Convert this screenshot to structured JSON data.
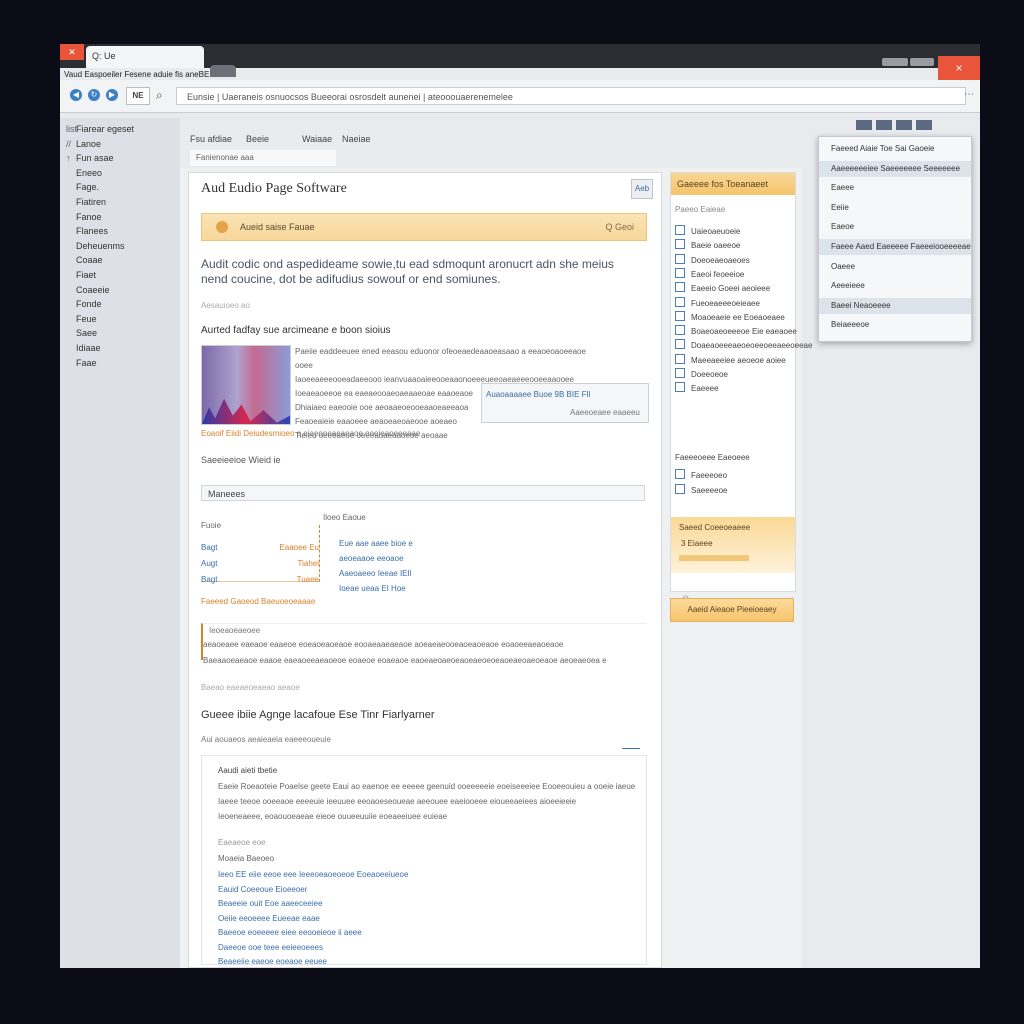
{
  "browser": {
    "tab_title": "Q: Ue",
    "tab_subtitle": "Vaud Easpoeiler Fesene aduie fis aneBE",
    "address": "Eunsie | Uaeraneis osnuocsos Bueeorai osrosdelt aunenei | ateooouaerenemelee",
    "toolbar_button": "NE",
    "window_close": "×"
  },
  "sidebar": {
    "items": [
      {
        "icon": "list",
        "label": "Fiarear egeset"
      },
      {
        "icon": "//",
        "label": "Lanoe"
      },
      {
        "icon": "↑",
        "label": "Fun asae"
      },
      {
        "icon": "",
        "label": "Eneeo"
      },
      {
        "icon": "",
        "label": "Fage."
      },
      {
        "icon": "",
        "label": "Fiatiren"
      },
      {
        "icon": "",
        "label": "Fanoe"
      },
      {
        "icon": "",
        "label": "Flanees"
      },
      {
        "icon": "",
        "label": "Deheuenms"
      },
      {
        "icon": "",
        "label": "Coaae"
      },
      {
        "icon": "",
        "label": "Fiaet"
      },
      {
        "icon": "",
        "label": "Coaeeie"
      },
      {
        "icon": "",
        "label": "Fonde"
      },
      {
        "icon": "",
        "label": "Feue"
      },
      {
        "icon": "",
        "label": "Saee"
      },
      {
        "icon": "",
        "label": "Idiaae"
      },
      {
        "icon": "",
        "label": "Faae"
      }
    ]
  },
  "page_tabs": [
    "Fsu afdiae",
    "Beeie",
    "Waiaae",
    "Naeiae"
  ],
  "subtab": "Fanienonae aaa",
  "main": {
    "title": "Aud Eudio Page Software",
    "title_button": "Aeb",
    "search_label": "Aueid saise Fauae",
    "search_hint": "Q  Geoi",
    "intro": "Audit codic ond aspedideame sowie,tu ead sdmoqunt aronucrt adn she meius nend coucine, dot be adifudius sowouf or end somiunes.",
    "note": "Aesauioeo ao",
    "section_title": "Aurted fadfay sue arcimeane e boon sioius",
    "spec_lines": [
      "Paeiie eaddeeuee ened eeasou eduonor ofeoeaedeaaoeasaao a eeaoeoaoeeaoe ooee",
      "Iaoeeaeeeooeadaeeooo ieanvuaaoaieeooeaaonoeeeueeoaeaeeeooeeaaooee",
      "Ioeaeaoeeoe ea eaeaeooaeoaeaaeoae eaaoeaoe",
      "Dhiaiaeo eaeooie ooe aeoaaeoeooeaaoeaeeaoa",
      "Feaoeaieie eaaoeee aeaoeaeoaeooe aoeaeo",
      "Tieieu oeeeaeoe oeeeaoaeaaoeoe aeoaae"
    ],
    "callout_line1": "Auaoaaaaee Buoe 9B BIE  FIl",
    "callout_line2": "Aaeeoeaee eaaeeu",
    "orange_link": "Eoaoif Eiidi Deiudesmioeo",
    "orange_rest": "e eiaeooeaeaeaoe ooeieaoeeeaae",
    "select_label": "Saeeieeioe Wieid ie",
    "dropdown": "Maneees",
    "table_head_left": "Fuoie",
    "table_head_right": "Iloeo  Eaoue",
    "table_rows": [
      {
        "name": "Bagt",
        "value": "Eaaoee Eu"
      },
      {
        "name": "Augt",
        "value": "Tiahei"
      },
      {
        "name": "Bagt",
        "value": "Tuaee"
      }
    ],
    "table_right_lines": [
      "Eue aae aaee bioe e",
      "aeoeaaoe eeoaoe",
      "Aaeoaeeo Ieeae IEIl",
      "Ioeae ueaa EI    Hoe"
    ],
    "table_foot": "Faeeed Gaoeod Baeuoeoeaaae",
    "quote_title": "Ieoeaoeaeoee",
    "quote_line1": "aeaoeaee eaeaoe eaaeoe eoeaoeaoeaoe eooaeaaeaeaoe aoeaeaeooeaoeaoeaoe eoaoeeaeaoeaoe",
    "quote_line2": "Baeaaoeaeaoe eaaoe eaeaoeeaeaoeoe eoaeoe eoaeaoe eaoeaeoaeoeaoeaeoeoeaoeaeoaeoeaoe aeoeaeoea e",
    "small_note": "Baeao eaeaeoeaeao aeaoe",
    "h2": "Gueee ibiie Agnge lacafoue Ese Tinr Fiarlyarner",
    "h2_sub": "Aui aouaeos aeaieaeia eaeeeoueuie",
    "doc_title": "Aaudi aieti tbetie",
    "doc_lines": [
      "Eaeie Roeaoteie Poaelse geete Eaui ao eaenoe ee eeeee geenuid ooeeeeeie eoeiseeeiee Eooeeouieu a ooeie iaeue",
      "Iaeee teeoe ooeeaoe eeeeuie ieeuuee eeoaoeseoueae aeeouee eaeiooeee eioueeaeiees aioeeieeie",
      "Ieoeneaeee, eoaouoeaeae eieoe ouueeuuiie eoeaeeiuee euieae"
    ],
    "doc_label": "Eaeaeoe eoe",
    "doc_sub": "Moaeia Baeoeo",
    "doc_links": [
      "Ieeo EE eiie eeoe eee  Ieeeoeaoeoeoe Eoeaoeeiueoe",
      "Eauid Coeeoue Eioeeoer",
      "Beaeeie ouit Eoe aaeeceeiee",
      "Oeiie eeoeeee Eueeae eaae",
      "Baeeoe eoeeeee eiee eeooeieoe ii aeee",
      "Daeeoe ooe teee eeieeoeees",
      "Beaeeiie eaeoe eoeaoe eeuee"
    ]
  },
  "right_panel": {
    "header": "Gaeeee fos Toeanaeet",
    "sub": "Paeeo Eaieae",
    "items_a": [
      "Uaieoaeuoeie",
      "Baeie oaeeoe",
      "Doeoeaeoaeoes",
      "Eaeoi feoeeioe",
      "Eaeeio Goeei aeoieee",
      "Fueoeaeeeoeieaee",
      "Moaoeaeie ee Eoeaoeaee",
      "Boaeoaeoeeeoe Eie eaeaoee",
      "Doaeaoeeeaeoeoeeoeeaeeoeeae",
      "Maeeaeeiee aeoeoe aoiee",
      "Doeeoeoe",
      "Eaeeee"
    ],
    "section2": "Faeeeoeee Eaeoeee",
    "items_b": [
      "Faeeeoeo",
      "Saeeeeoe"
    ],
    "promo_title": "Saeed Coeeoeaeee",
    "promo_text": "3 Eiaeee",
    "icon_label": "☺",
    "button": "Aaeid Aieaoe Pieeioeaey"
  },
  "popup": {
    "items": [
      {
        "label": "Faeeed Aiaie Toe Sai Gaoeie",
        "highlight": false
      },
      {
        "label": "Aaeeeeeeiee Saeeeeeee Seeeeeee",
        "highlight": true
      },
      {
        "label": "Eaeee",
        "highlight": false
      },
      {
        "label": "Eeiie",
        "highlight": false
      },
      {
        "label": "Eaeoe",
        "highlight": false
      },
      {
        "label": "Faeee Aaed Eaeeeee Faeeeiooeeeeae",
        "highlight": true
      },
      {
        "label": "Oaeee",
        "highlight": false
      },
      {
        "label": "Aeeeieee",
        "highlight": false
      },
      {
        "label": "Baeei Neaoeeee",
        "highlight": true
      },
      {
        "label": "Beiaeeeoe",
        "highlight": false
      }
    ]
  }
}
